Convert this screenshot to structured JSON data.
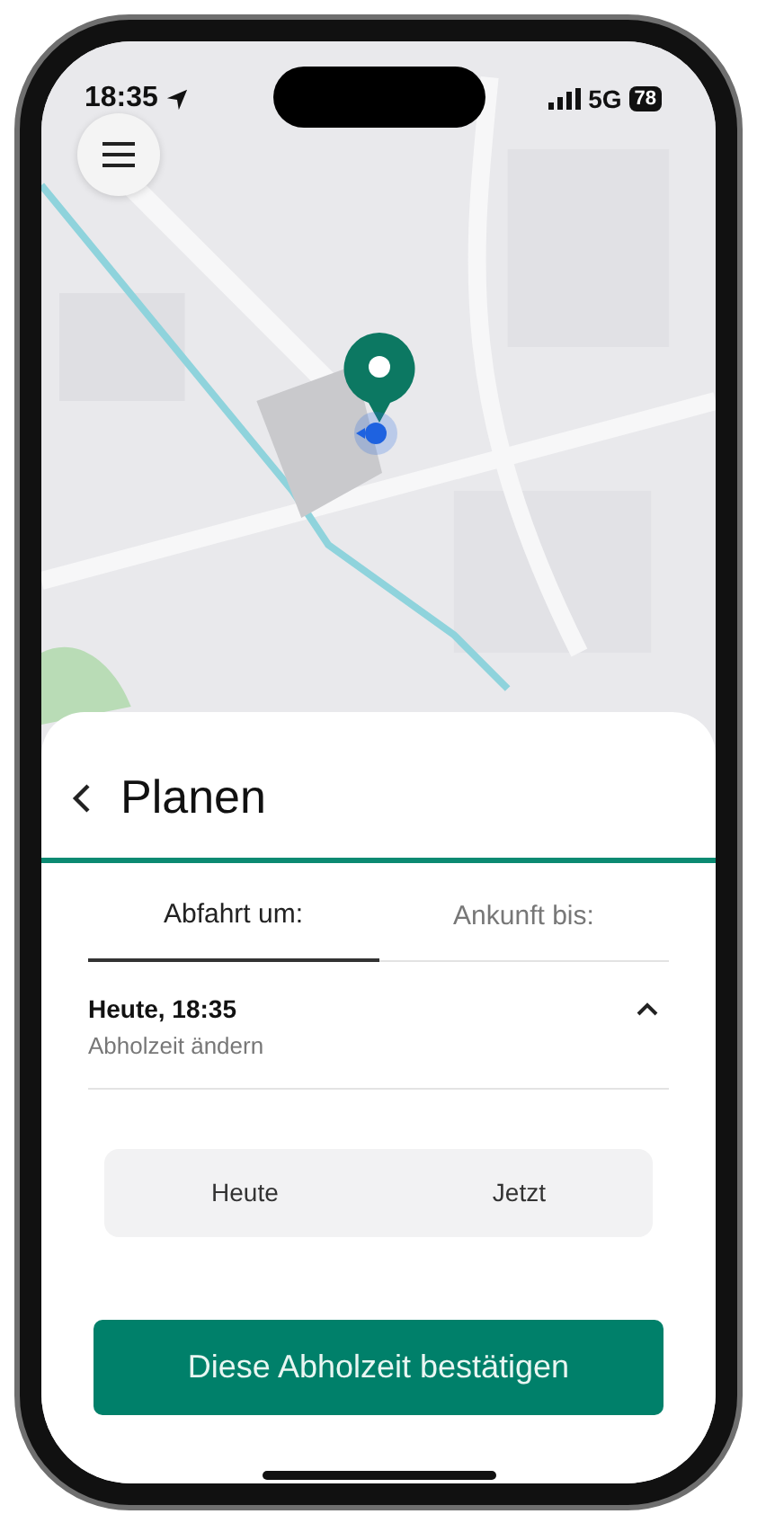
{
  "status_bar": {
    "time": "18:35",
    "network": "5G",
    "battery": "78"
  },
  "sheet": {
    "title": "Planen",
    "tabs": [
      {
        "label": "Abfahrt um:",
        "selected": true
      },
      {
        "label": "Ankunft bis:",
        "selected": false
      }
    ],
    "pickup": {
      "title": "Heute, 18:35",
      "subtitle": "Abholzeit ändern",
      "expanded": true
    },
    "picker": {
      "columns": [
        "Heute",
        "Jetzt"
      ]
    },
    "confirm_button": "Diese Abholzeit bestätigen"
  }
}
